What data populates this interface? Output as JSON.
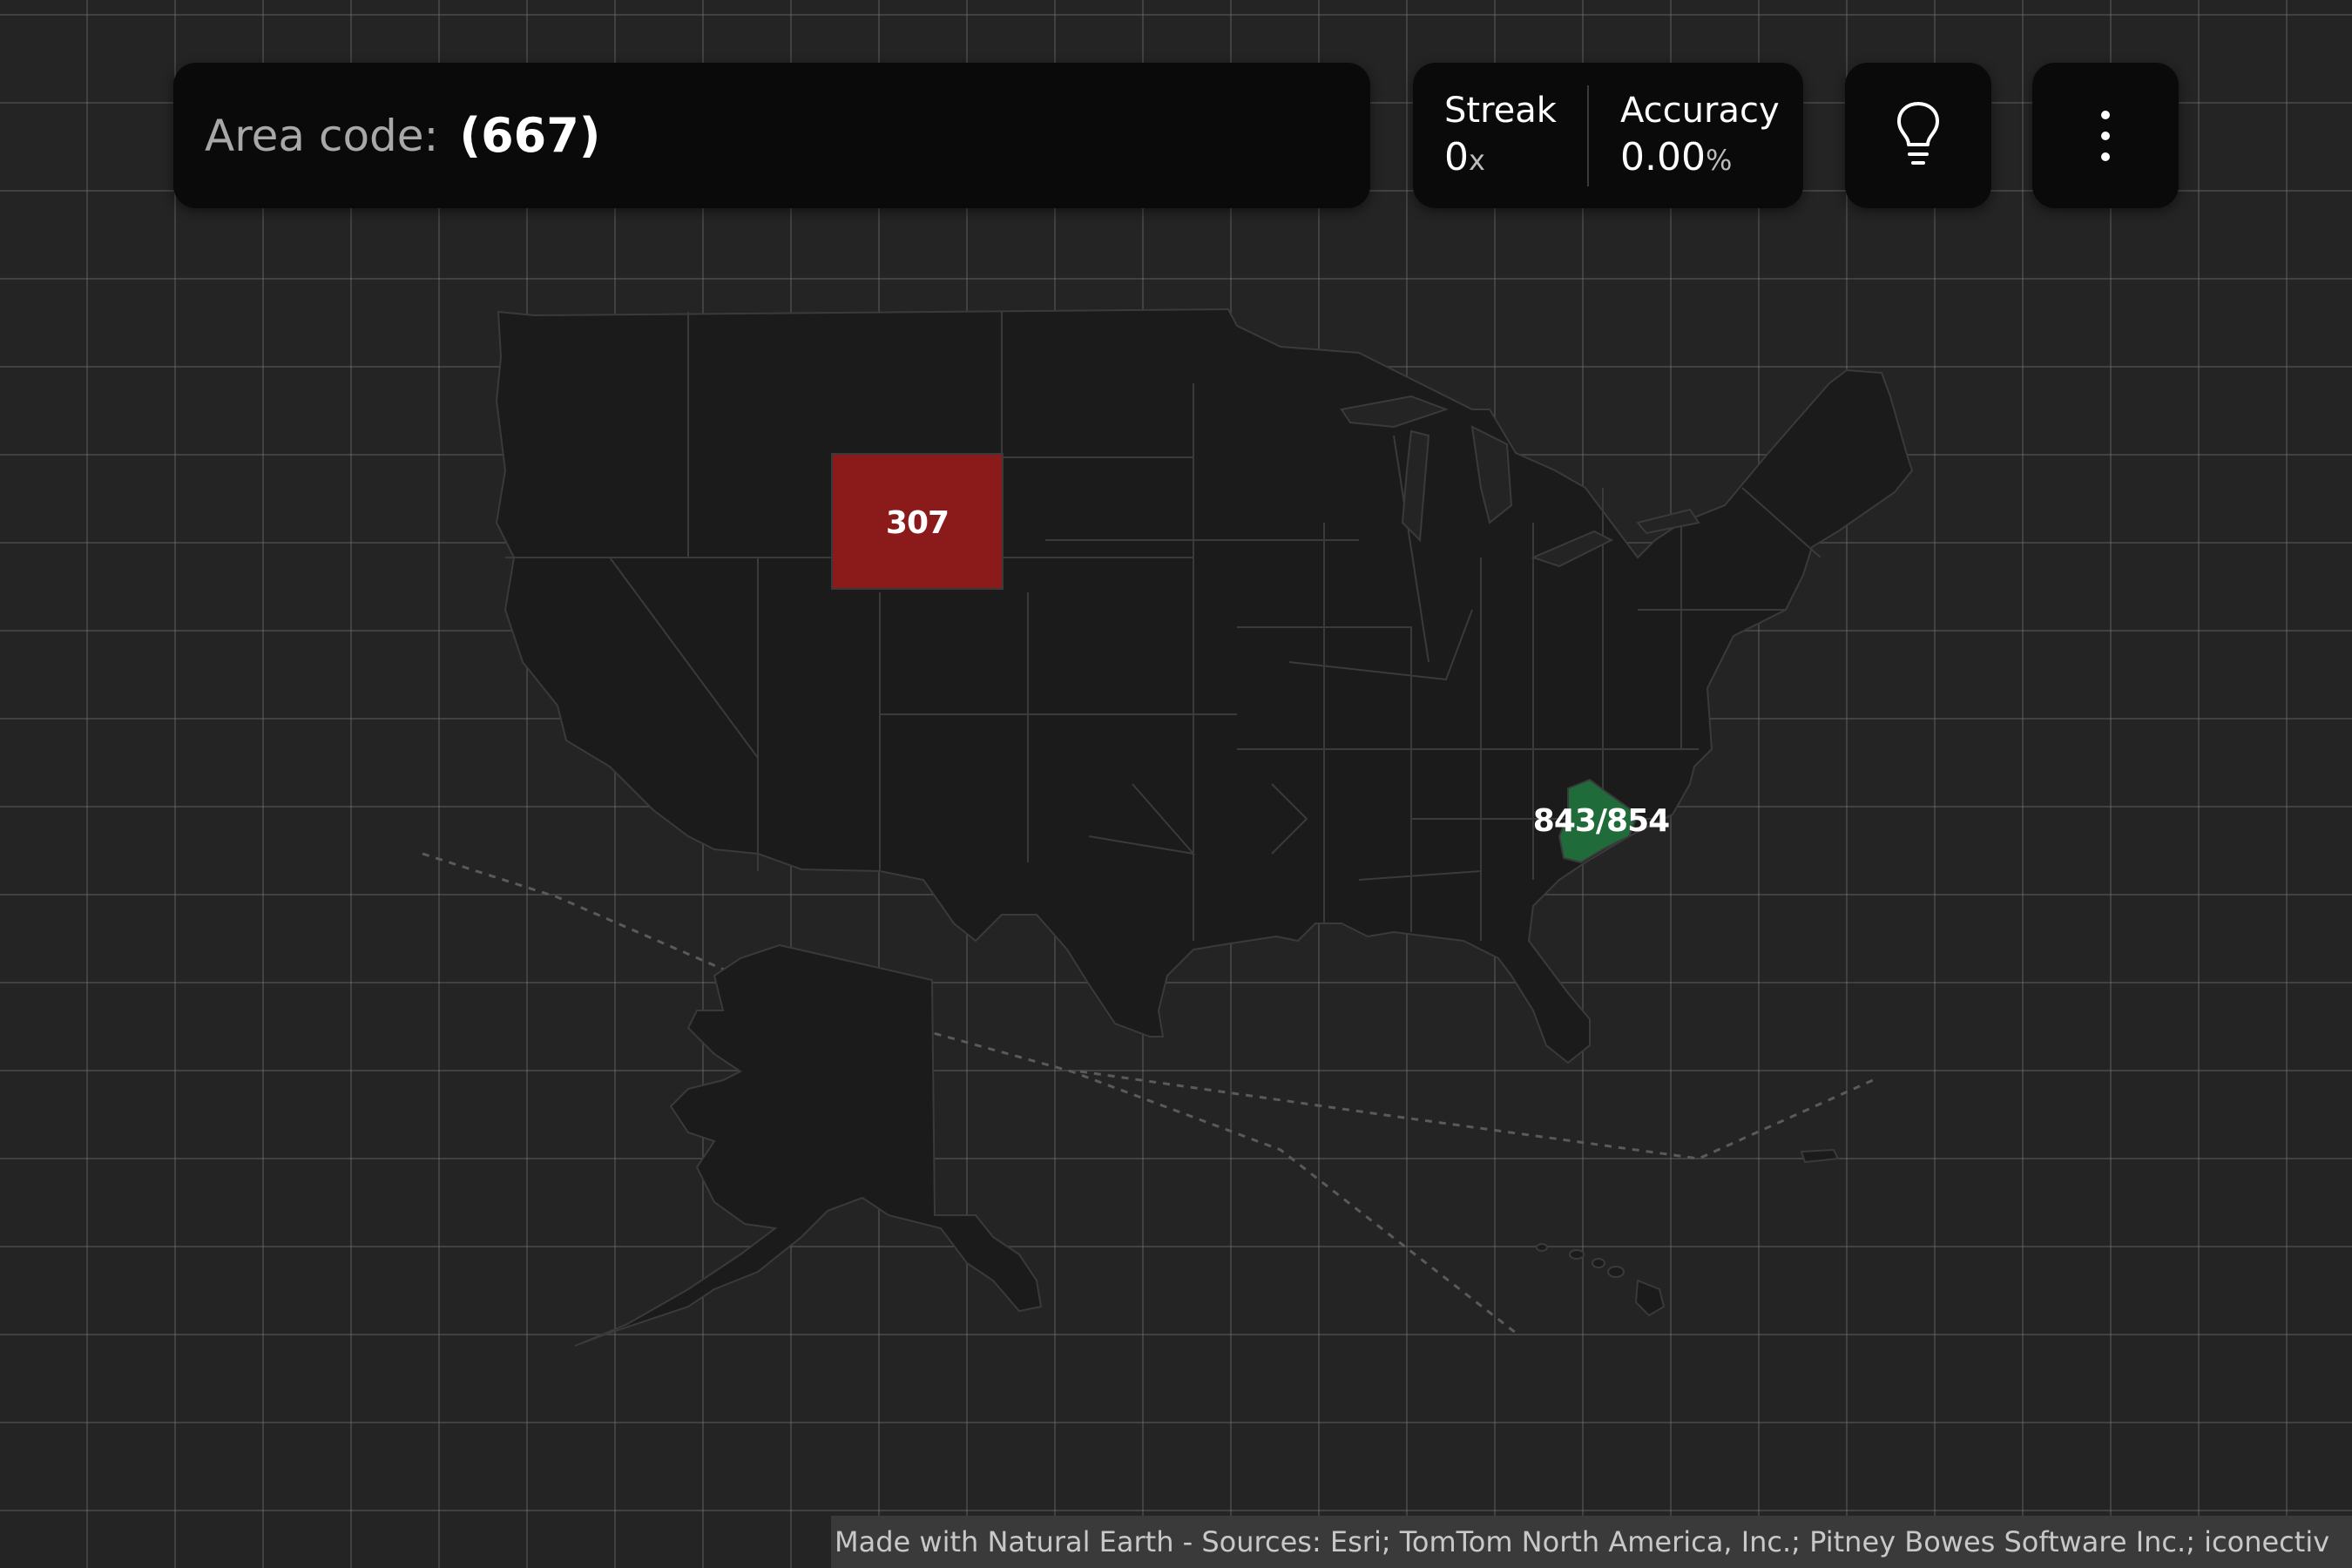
{
  "prompt": {
    "label": "Area code:",
    "code": "(667)"
  },
  "stats": {
    "streak": {
      "title": "Streak",
      "value": "0",
      "unit": "x"
    },
    "accuracy": {
      "title": "Accuracy",
      "value": "0.00",
      "unit": "%"
    }
  },
  "buttons": {
    "hint_icon": "lightbulb-icon",
    "menu_icon": "more-vertical-icon"
  },
  "map": {
    "regions_highlighted": [
      {
        "label": "307",
        "status": "incorrect",
        "color": "#8b1a1a"
      },
      {
        "label": "843/854",
        "status": "correct",
        "color": "#1f6b3a"
      }
    ],
    "colors": {
      "land": "#1b1b1b",
      "border": "#3a3a3a",
      "background": "#242424"
    }
  },
  "attribution": "Made with Natural Earth - Sources: Esri; TomTom North America, Inc.; Pitney Bowes Software Inc.; iconectiv"
}
